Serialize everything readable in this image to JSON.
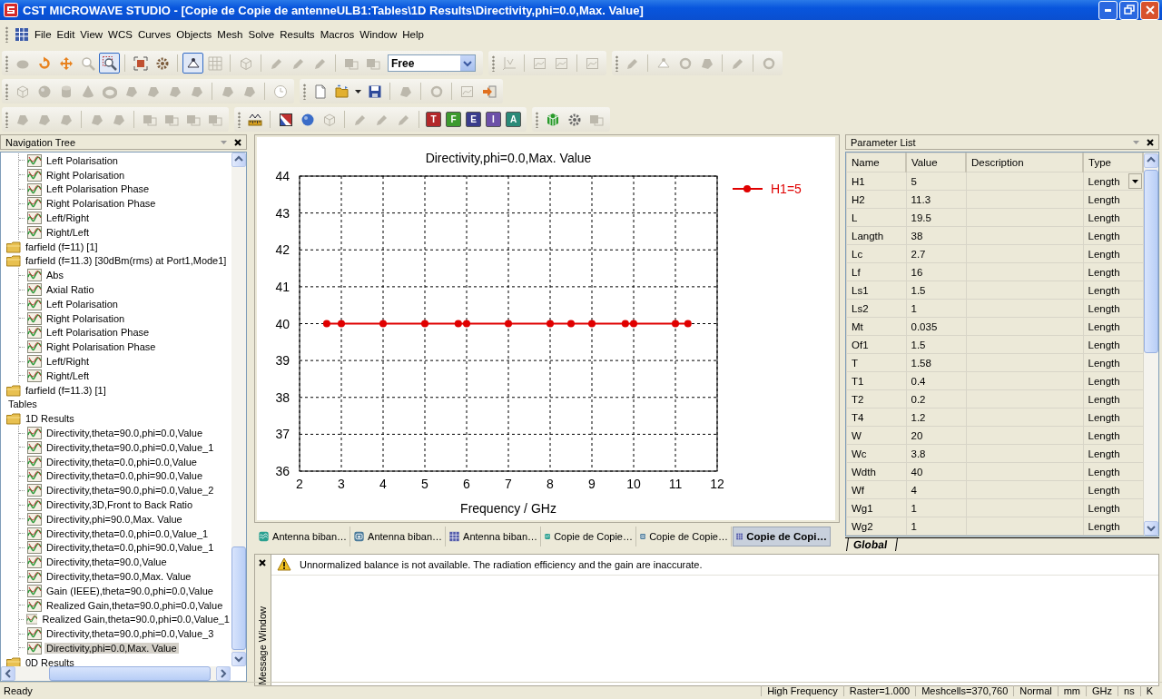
{
  "window": {
    "title": "CST MICROWAVE STUDIO - [Copie de Copie de antenneULB1:Tables\\1D Results\\Directivity,phi=0.0,Max. Value]"
  },
  "menu": [
    "File",
    "Edit",
    "View",
    "WCS",
    "Curves",
    "Objects",
    "Mesh",
    "Solve",
    "Results",
    "Macros",
    "Window",
    "Help"
  ],
  "toolbars": [
    {
      "bars": [
        {
          "items": [
            {
              "kind": "button",
              "disabled": true,
              "selected": false
            },
            {
              "kind": "button",
              "disabled": false,
              "selected": false
            },
            {
              "kind": "button",
              "disabled": false,
              "selected": false
            },
            {
              "kind": "button",
              "disabled": true,
              "selected": false
            },
            {
              "kind": "button",
              "disabled": false,
              "selected": true
            },
            {
              "kind": "separator"
            },
            {
              "kind": "button",
              "disabled": false,
              "selected": false
            },
            {
              "kind": "button",
              "disabled": false,
              "selected": false
            },
            {
              "kind": "separator"
            },
            {
              "kind": "button",
              "disabled": false,
              "selected": true
            },
            {
              "kind": "button",
              "disabled": true,
              "selected": false
            },
            {
              "kind": "separator"
            },
            {
              "kind": "button",
              "disabled": true,
              "selected": false
            },
            {
              "kind": "separator"
            },
            {
              "kind": "button",
              "disabled": true,
              "selected": false
            },
            {
              "kind": "button",
              "disabled": true,
              "selected": false
            },
            {
              "kind": "button",
              "disabled": true,
              "selected": false
            },
            {
              "kind": "separator"
            },
            {
              "kind": "button",
              "disabled": true,
              "selected": false
            },
            {
              "kind": "button",
              "disabled": true,
              "selected": false
            },
            {
              "kind": "combo",
              "value": "Free"
            }
          ]
        },
        {
          "items": [
            {
              "kind": "button",
              "disabled": true,
              "selected": false
            },
            {
              "kind": "separator"
            },
            {
              "kind": "button",
              "disabled": true,
              "selected": false
            },
            {
              "kind": "button",
              "disabled": true,
              "selected": false
            },
            {
              "kind": "separator"
            },
            {
              "kind": "button",
              "disabled": true,
              "selected": false
            }
          ]
        },
        {
          "items": [
            {
              "kind": "button",
              "disabled": true,
              "selected": false
            },
            {
              "kind": "separator"
            },
            {
              "kind": "button",
              "disabled": true,
              "selected": false
            },
            {
              "kind": "button",
              "disabled": true,
              "selected": false
            },
            {
              "kind": "button",
              "disabled": true,
              "selected": false
            },
            {
              "kind": "separator"
            },
            {
              "kind": "button",
              "disabled": true,
              "selected": false
            },
            {
              "kind": "separator"
            },
            {
              "kind": "button",
              "disabled": true,
              "selected": false
            }
          ]
        }
      ]
    },
    {
      "bars": [
        {
          "items": [
            {
              "kind": "button",
              "disabled": true,
              "selected": false
            },
            {
              "kind": "button",
              "disabled": true,
              "selected": false
            },
            {
              "kind": "button",
              "disabled": true,
              "selected": false
            },
            {
              "kind": "button",
              "disabled": true,
              "selected": false
            },
            {
              "kind": "button",
              "disabled": true,
              "selected": false
            },
            {
              "kind": "button",
              "disabled": true,
              "selected": false
            },
            {
              "kind": "button",
              "disabled": true,
              "selected": false
            },
            {
              "kind": "button",
              "disabled": true,
              "selected": false
            },
            {
              "kind": "button",
              "disabled": true,
              "selected": false
            },
            {
              "kind": "separator"
            },
            {
              "kind": "button",
              "disabled": true,
              "selected": false
            },
            {
              "kind": "button",
              "disabled": true,
              "selected": false
            },
            {
              "kind": "separator"
            },
            {
              "kind": "button",
              "disabled": true,
              "selected": false
            }
          ]
        },
        {
          "items": [
            {
              "kind": "button",
              "disabled": false,
              "selected": false
            },
            {
              "kind": "button",
              "disabled": false,
              "selected": false
            },
            {
              "kind": "button",
              "disabled": false,
              "selected": false
            },
            {
              "kind": "button",
              "disabled": false,
              "selected": false
            },
            {
              "kind": "separator"
            },
            {
              "kind": "button",
              "disabled": true,
              "selected": false
            },
            {
              "kind": "separator"
            },
            {
              "kind": "button",
              "disabled": true,
              "selected": false
            },
            {
              "kind": "separator"
            },
            {
              "kind": "button",
              "disabled": true,
              "selected": false
            },
            {
              "kind": "button",
              "disabled": false,
              "selected": false
            }
          ]
        }
      ]
    },
    {
      "bars": [
        {
          "items": [
            {
              "kind": "button",
              "disabled": true,
              "selected": false
            },
            {
              "kind": "button",
              "disabled": true,
              "selected": false
            },
            {
              "kind": "button",
              "disabled": true,
              "selected": false
            },
            {
              "kind": "separator"
            },
            {
              "kind": "button",
              "disabled": true,
              "selected": false
            },
            {
              "kind": "button",
              "disabled": true,
              "selected": false
            },
            {
              "kind": "separator"
            },
            {
              "kind": "button",
              "disabled": true,
              "selected": false
            },
            {
              "kind": "button",
              "disabled": true,
              "selected": false
            },
            {
              "kind": "button",
              "disabled": true,
              "selected": false
            },
            {
              "kind": "button",
              "disabled": true,
              "selected": false
            }
          ]
        },
        {
          "items": [
            {
              "kind": "button",
              "disabled": false,
              "selected": false
            },
            {
              "kind": "separator"
            },
            {
              "kind": "button",
              "disabled": false,
              "selected": false
            },
            {
              "kind": "button",
              "disabled": false,
              "selected": false
            },
            {
              "kind": "button",
              "disabled": true,
              "selected": false
            },
            {
              "kind": "separator"
            },
            {
              "kind": "button",
              "disabled": true,
              "selected": false
            },
            {
              "kind": "button",
              "disabled": true,
              "selected": false
            },
            {
              "kind": "button",
              "disabled": true,
              "selected": false
            },
            {
              "kind": "separator"
            },
            {
              "kind": "solver",
              "label": "T",
              "color": "#b3282a"
            },
            {
              "kind": "solver",
              "label": "F",
              "color": "#3c9a2e"
            },
            {
              "kind": "solver",
              "label": "E",
              "color": "#3a3c8c"
            },
            {
              "kind": "solver",
              "label": "I",
              "color": "#6c50a8"
            },
            {
              "kind": "solver",
              "label": "A",
              "color": "#2a8a78"
            }
          ]
        },
        {
          "items": [
            {
              "kind": "button",
              "disabled": false,
              "selected": false
            },
            {
              "kind": "button",
              "disabled": false,
              "selected": false
            },
            {
              "kind": "button",
              "disabled": true,
              "selected": false
            }
          ]
        }
      ]
    }
  ],
  "navigation_tree": {
    "title": "Navigation Tree",
    "items": [
      {
        "kind": "group",
        "children": [
          {
            "kind": "curve",
            "label": "Left Polarisation",
            "selected": false
          },
          {
            "kind": "curve",
            "label": "Right Polarisation",
            "selected": false
          },
          {
            "kind": "curve",
            "label": "Left Polarisation Phase",
            "selected": false
          },
          {
            "kind": "curve",
            "label": "Right Polarisation Phase",
            "selected": false
          },
          {
            "kind": "curve",
            "label": "Left/Right",
            "selected": false
          },
          {
            "kind": "curve",
            "label": "Right/Left",
            "selected": false
          }
        ]
      },
      {
        "kind": "folder",
        "label": "farfield (f=11) [1]",
        "selected": false
      },
      {
        "kind": "folder",
        "label": "farfield (f=11.3) [30dBm(rms) at Port1,Mode1]",
        "selected": false,
        "children": [
          {
            "kind": "curve",
            "label": "Abs",
            "selected": false
          },
          {
            "kind": "curve",
            "label": "Axial Ratio",
            "selected": false
          },
          {
            "kind": "curve",
            "label": "Left Polarisation",
            "selected": false
          },
          {
            "kind": "curve",
            "label": "Right Polarisation",
            "selected": false
          },
          {
            "kind": "curve",
            "label": "Left Polarisation Phase",
            "selected": false
          },
          {
            "kind": "curve",
            "label": "Right Polarisation Phase",
            "selected": false
          },
          {
            "kind": "curve",
            "label": "Left/Right",
            "selected": false
          },
          {
            "kind": "curve",
            "label": "Right/Left",
            "selected": false
          }
        ]
      },
      {
        "kind": "folder",
        "label": "farfield (f=11.3) [1]",
        "selected": false
      },
      {
        "kind": "heading",
        "label": "Tables",
        "selected": false
      },
      {
        "kind": "folder",
        "label": "1D Results",
        "selected": false,
        "children": [
          {
            "kind": "curve",
            "label": "Directivity,theta=90.0,phi=0.0,Value",
            "selected": false
          },
          {
            "kind": "curve",
            "label": "Directivity,theta=90.0,phi=0.0,Value_1",
            "selected": false
          },
          {
            "kind": "curve",
            "label": "Directivity,theta=0.0,phi=0.0,Value",
            "selected": false
          },
          {
            "kind": "curve",
            "label": "Directivity,theta=0.0,phi=90.0,Value",
            "selected": false
          },
          {
            "kind": "curve",
            "label": "Directivity,theta=90.0,phi=0.0,Value_2",
            "selected": false
          },
          {
            "kind": "curve",
            "label": "Directivity,3D,Front to Back Ratio",
            "selected": false
          },
          {
            "kind": "curve",
            "label": "Directivity,phi=90.0,Max. Value",
            "selected": false
          },
          {
            "kind": "curve",
            "label": "Directivity,theta=0.0,phi=0.0,Value_1",
            "selected": false
          },
          {
            "kind": "curve",
            "label": "Directivity,theta=0.0,phi=90.0,Value_1",
            "selected": false
          },
          {
            "kind": "curve",
            "label": "Directivity,theta=90.0,Value",
            "selected": false
          },
          {
            "kind": "curve",
            "label": "Directivity,theta=90.0,Max. Value",
            "selected": false
          },
          {
            "kind": "curve",
            "label": "Gain (IEEE),theta=90.0,phi=0.0,Value",
            "selected": false
          },
          {
            "kind": "curve",
            "label": "Realized Gain,theta=90.0,phi=0.0,Value",
            "selected": false
          },
          {
            "kind": "curve",
            "label": "Realized Gain,theta=90.0,phi=0.0,Value_1",
            "selected": false
          },
          {
            "kind": "curve",
            "label": "Directivity,theta=90.0,phi=0.0,Value_3",
            "selected": false
          },
          {
            "kind": "curve",
            "label": "Directivity,phi=0.0,Max. Value",
            "selected": true
          }
        ]
      },
      {
        "kind": "folder",
        "label": "0D Results",
        "selected": false
      }
    ]
  },
  "chart_panel": {
    "chart_data": {
      "type": "line",
      "title": "Directivity,phi=0.0,Max. Value",
      "xlabel": "Frequency / GHz",
      "x": [
        2.65,
        3,
        4,
        5,
        5.8,
        6,
        7,
        8,
        8.5,
        9,
        9.8,
        10,
        11,
        11.3
      ],
      "series": [
        {
          "name": "H1=5",
          "color": "#e00000",
          "marker": "circle",
          "values": [
            40,
            40,
            40,
            40,
            40,
            40,
            40,
            40,
            40,
            40,
            40,
            40,
            40,
            40
          ]
        }
      ],
      "xlim": [
        2,
        12
      ],
      "ylim": [
        36,
        44
      ],
      "grid": true,
      "xticks": [
        2,
        3,
        4,
        5,
        6,
        7,
        8,
        9,
        10,
        11,
        12
      ],
      "yticks": [
        36,
        37,
        38,
        39,
        40,
        41,
        42,
        43,
        44
      ]
    },
    "tabs": [
      {
        "label": "Antenna biban…",
        "kind": "plot",
        "selected": false
      },
      {
        "label": "Antenna biban…",
        "kind": "schematic",
        "selected": false
      },
      {
        "label": "Antenna biban…",
        "kind": "table",
        "selected": false
      },
      {
        "label": "Copie de Copie…",
        "kind": "plot",
        "selected": false
      },
      {
        "label": "Copie de Copie…",
        "kind": "schematic",
        "selected": false
      },
      {
        "label": "Copie de Copi…",
        "kind": "table",
        "selected": true
      }
    ]
  },
  "parameter_list": {
    "title": "Parameter List",
    "columns": [
      "Name",
      "Value",
      "Description",
      "Type"
    ],
    "rows": [
      {
        "name": "H1",
        "value": "5",
        "type": "Length",
        "dropdown": true
      },
      {
        "name": "H2",
        "value": "11.3",
        "type": "Length",
        "dropdown": false
      },
      {
        "name": "L",
        "value": "19.5",
        "type": "Length",
        "dropdown": false
      },
      {
        "name": "Langth",
        "value": "38",
        "type": "Length",
        "dropdown": false
      },
      {
        "name": "Lc",
        "value": "2.7",
        "type": "Length",
        "dropdown": false
      },
      {
        "name": "Lf",
        "value": "16",
        "type": "Length",
        "dropdown": false
      },
      {
        "name": "Ls1",
        "value": "1.5",
        "type": "Length",
        "dropdown": false
      },
      {
        "name": "Ls2",
        "value": "1",
        "type": "Length",
        "dropdown": false
      },
      {
        "name": "Mt",
        "value": "0.035",
        "type": "Length",
        "dropdown": false
      },
      {
        "name": "Of1",
        "value": "1.5",
        "type": "Length",
        "dropdown": false
      },
      {
        "name": "T",
        "value": "1.58",
        "type": "Length",
        "dropdown": false
      },
      {
        "name": "T1",
        "value": "0.4",
        "type": "Length",
        "dropdown": false
      },
      {
        "name": "T2",
        "value": "0.2",
        "type": "Length",
        "dropdown": false
      },
      {
        "name": "T4",
        "value": "1.2",
        "type": "Length",
        "dropdown": false
      },
      {
        "name": "W",
        "value": "20",
        "type": "Length",
        "dropdown": false
      },
      {
        "name": "Wc",
        "value": "3.8",
        "type": "Length",
        "dropdown": false
      },
      {
        "name": "Wdth",
        "value": "40",
        "type": "Length",
        "dropdown": false
      },
      {
        "name": "Wf",
        "value": "4",
        "type": "Length",
        "dropdown": false
      },
      {
        "name": "Wg1",
        "value": "1",
        "type": "Length",
        "dropdown": false
      },
      {
        "name": "Wg2",
        "value": "1",
        "type": "Length",
        "dropdown": false
      }
    ],
    "sheet_tabs": [
      {
        "label": "Global",
        "selected": true
      }
    ]
  },
  "message_window": {
    "title": "Message Window",
    "messages": [
      {
        "kind": "warning",
        "text": "Unnormalized balance is not available. The radiation efficiency and the gain are inaccurate."
      }
    ]
  },
  "status_bar": {
    "message": "Ready",
    "fields": [
      "High Frequency",
      "Raster=1.000",
      "Meshcells=370,760",
      "Normal",
      "mm",
      "GHz",
      "ns",
      "K"
    ]
  }
}
